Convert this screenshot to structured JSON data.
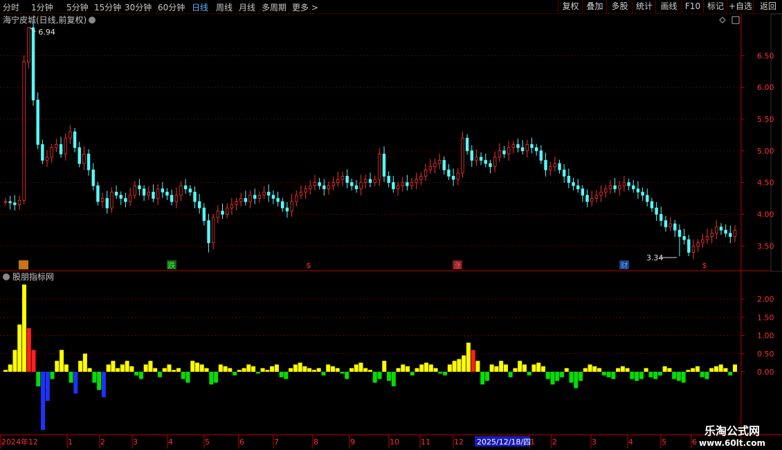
{
  "toolbar": {
    "period_tabs": [
      "分时",
      "1分钟",
      "5分钟",
      "15分钟",
      "30分钟",
      "60分钟",
      "日线",
      "周线",
      "月线",
      "多周期",
      "更多 >"
    ],
    "active_tab": "日线",
    "right_buttons": [
      "复权",
      "叠加",
      "多股",
      "统计",
      "画线",
      "F10",
      "标记",
      "+自选",
      "返回"
    ]
  },
  "main_panel": {
    "title": "海宁皮城(日线,前复权)",
    "price_ticks": [
      "6.50",
      "6.00",
      "5.50",
      "5.00",
      "4.50",
      "4.00",
      "3.50"
    ],
    "high_label": "6.94",
    "low_label": "3.34",
    "event_markers": [
      {
        "text": "榜",
        "color": "#ff5050",
        "box": "#b48000"
      },
      {
        "text": "跌",
        "color": "#30ff30",
        "box": "#1c5a1c"
      },
      {
        "text": "$",
        "color": "#ff3030",
        "box": ""
      },
      {
        "text": "涨",
        "color": "#ff6060",
        "box": "#7a1a1a"
      },
      {
        "text": "财",
        "color": "#5aa0ff",
        "box": "#1a3c7a"
      },
      {
        "text": "$",
        "color": "#ff3030",
        "box": ""
      }
    ]
  },
  "sub_panel": {
    "title": "股朋指标网",
    "ticks": [
      "2.00",
      "1.50",
      "1.00",
      "0.50",
      "0.00"
    ]
  },
  "time_axis": {
    "labels": [
      "2024年12",
      "1",
      "2",
      "3",
      "4",
      "5",
      "6",
      "7",
      "8",
      "9",
      "10",
      "11",
      "12",
      "1",
      "2",
      "3",
      "4",
      "5",
      "6"
    ],
    "cursor_date": "2025/12/18/四"
  },
  "watermark": {
    "line1": "乐淘公式网",
    "line2": "www.60lt.com"
  },
  "colors": {
    "up": "#ff3232",
    "down": "#54ffff",
    "grid": "#6a0000",
    "axis": "#c00000",
    "bar_pos": "#ffff00",
    "bar_pos2": "#ff2020",
    "bar_neg": "#00e000",
    "bar_neg2": "#1e32ff"
  },
  "chart_data": {
    "type": "candlestick",
    "price_series_close": [
      4.2,
      4.18,
      4.15,
      4.22,
      6.4,
      6.94,
      5.8,
      5.1,
      4.85,
      4.9,
      5.05,
      5.1,
      4.95,
      5.2,
      5.3,
      5.05,
      4.8,
      4.95,
      4.7,
      4.45,
      4.2,
      4.25,
      4.1,
      4.35,
      4.3,
      4.25,
      4.2,
      4.3,
      4.45,
      4.4,
      4.3,
      4.35,
      4.25,
      4.4,
      4.35,
      4.3,
      4.2,
      4.3,
      4.45,
      4.4,
      4.35,
      4.2,
      4.1,
      3.9,
      3.55,
      3.95,
      4.05,
      4.0,
      4.1,
      4.15,
      4.2,
      4.25,
      4.2,
      4.3,
      4.25,
      4.3,
      4.35,
      4.3,
      4.25,
      4.2,
      4.1,
      4.05,
      4.2,
      4.3,
      4.35,
      4.4,
      4.45,
      4.5,
      4.45,
      4.4,
      4.45,
      4.5,
      4.55,
      4.6,
      4.5,
      4.45,
      4.4,
      4.5,
      4.55,
      4.5,
      4.55,
      4.95,
      4.6,
      4.5,
      4.4,
      4.45,
      4.5,
      4.45,
      4.5,
      4.55,
      4.6,
      4.7,
      4.75,
      4.8,
      4.85,
      4.7,
      4.6,
      4.55,
      4.65,
      5.2,
      5.0,
      4.85,
      4.9,
      4.85,
      4.8,
      4.75,
      4.9,
      5.0,
      4.95,
      5.05,
      5.1,
      5.05,
      5.0,
      5.1,
      5.05,
      5.0,
      4.85,
      4.7,
      4.75,
      4.8,
      4.7,
      4.6,
      4.5,
      4.45,
      4.4,
      4.3,
      4.2,
      4.25,
      4.3,
      4.35,
      4.4,
      4.45,
      4.4,
      4.45,
      4.5,
      4.45,
      4.4,
      4.35,
      4.3,
      4.2,
      4.1,
      4.0,
      3.9,
      3.8,
      3.85,
      3.75,
      3.65,
      3.6,
      3.4,
      3.5,
      3.55,
      3.6,
      3.65,
      3.7,
      3.8,
      3.75,
      3.7,
      3.65,
      3.75
    ],
    "indicator_values": [
      0.05,
      0.2,
      0.6,
      1.3,
      2.4,
      1.2,
      0.6,
      -0.4,
      -1.6,
      -0.8,
      -0.2,
      0.3,
      0.6,
      0.2,
      -0.3,
      -0.6,
      0.3,
      0.5,
      0.1,
      -0.3,
      -0.5,
      -0.7,
      0.2,
      0.3,
      0.1,
      0.2,
      0.3,
      0.15,
      -0.1,
      -0.2,
      0.2,
      0.3,
      0.1,
      -0.15,
      0.1,
      0.2,
      0.05,
      0.1,
      -0.2,
      -0.3,
      0.3,
      0.25,
      0.2,
      0.1,
      -0.35,
      -0.3,
      0.2,
      0.15,
      0.1,
      -0.1,
      0.05,
      0.1,
      0.2,
      0.15,
      -0.05,
      0.1,
      0.05,
      0.15,
      0.2,
      -0.15,
      -0.2,
      0.1,
      0.2,
      0.25,
      0.15,
      0.1,
      0.05,
      0.1,
      -0.1,
      0.2,
      0.15,
      0.1,
      -0.05,
      -0.2,
      0.1,
      0.2,
      0.25,
      0.1,
      0.05,
      -0.3,
      -0.2,
      0.3,
      -0.25,
      -0.4,
      0.1,
      0.2,
      0.15,
      -0.1,
      0.1,
      0.2,
      0.25,
      0.2,
      0.1,
      -0.05,
      -0.1,
      0.2,
      0.3,
      0.35,
      0.45,
      0.8,
      0.6,
      0.3,
      -0.35,
      -0.25,
      0.2,
      0.15,
      0.3,
      0.2,
      -0.15,
      0.1,
      0.3,
      0.2,
      -0.1,
      0.2,
      0.25,
      0.15,
      -0.2,
      -0.35,
      -0.25,
      -0.15,
      0.1,
      -0.3,
      -0.45,
      -0.25,
      0.1,
      0.2,
      0.15,
      0.1,
      -0.1,
      -0.15,
      -0.2,
      0.1,
      0.15,
      0.1,
      -0.2,
      -0.25,
      -0.2,
      0.1,
      -0.15,
      -0.2,
      -0.1,
      0.15,
      0.1,
      -0.2,
      -0.25,
      -0.3,
      0.05,
      0.1,
      0.15,
      -0.15,
      -0.2,
      0.1,
      0.15,
      0.2,
      0.1,
      -0.1,
      0.2
    ]
  }
}
